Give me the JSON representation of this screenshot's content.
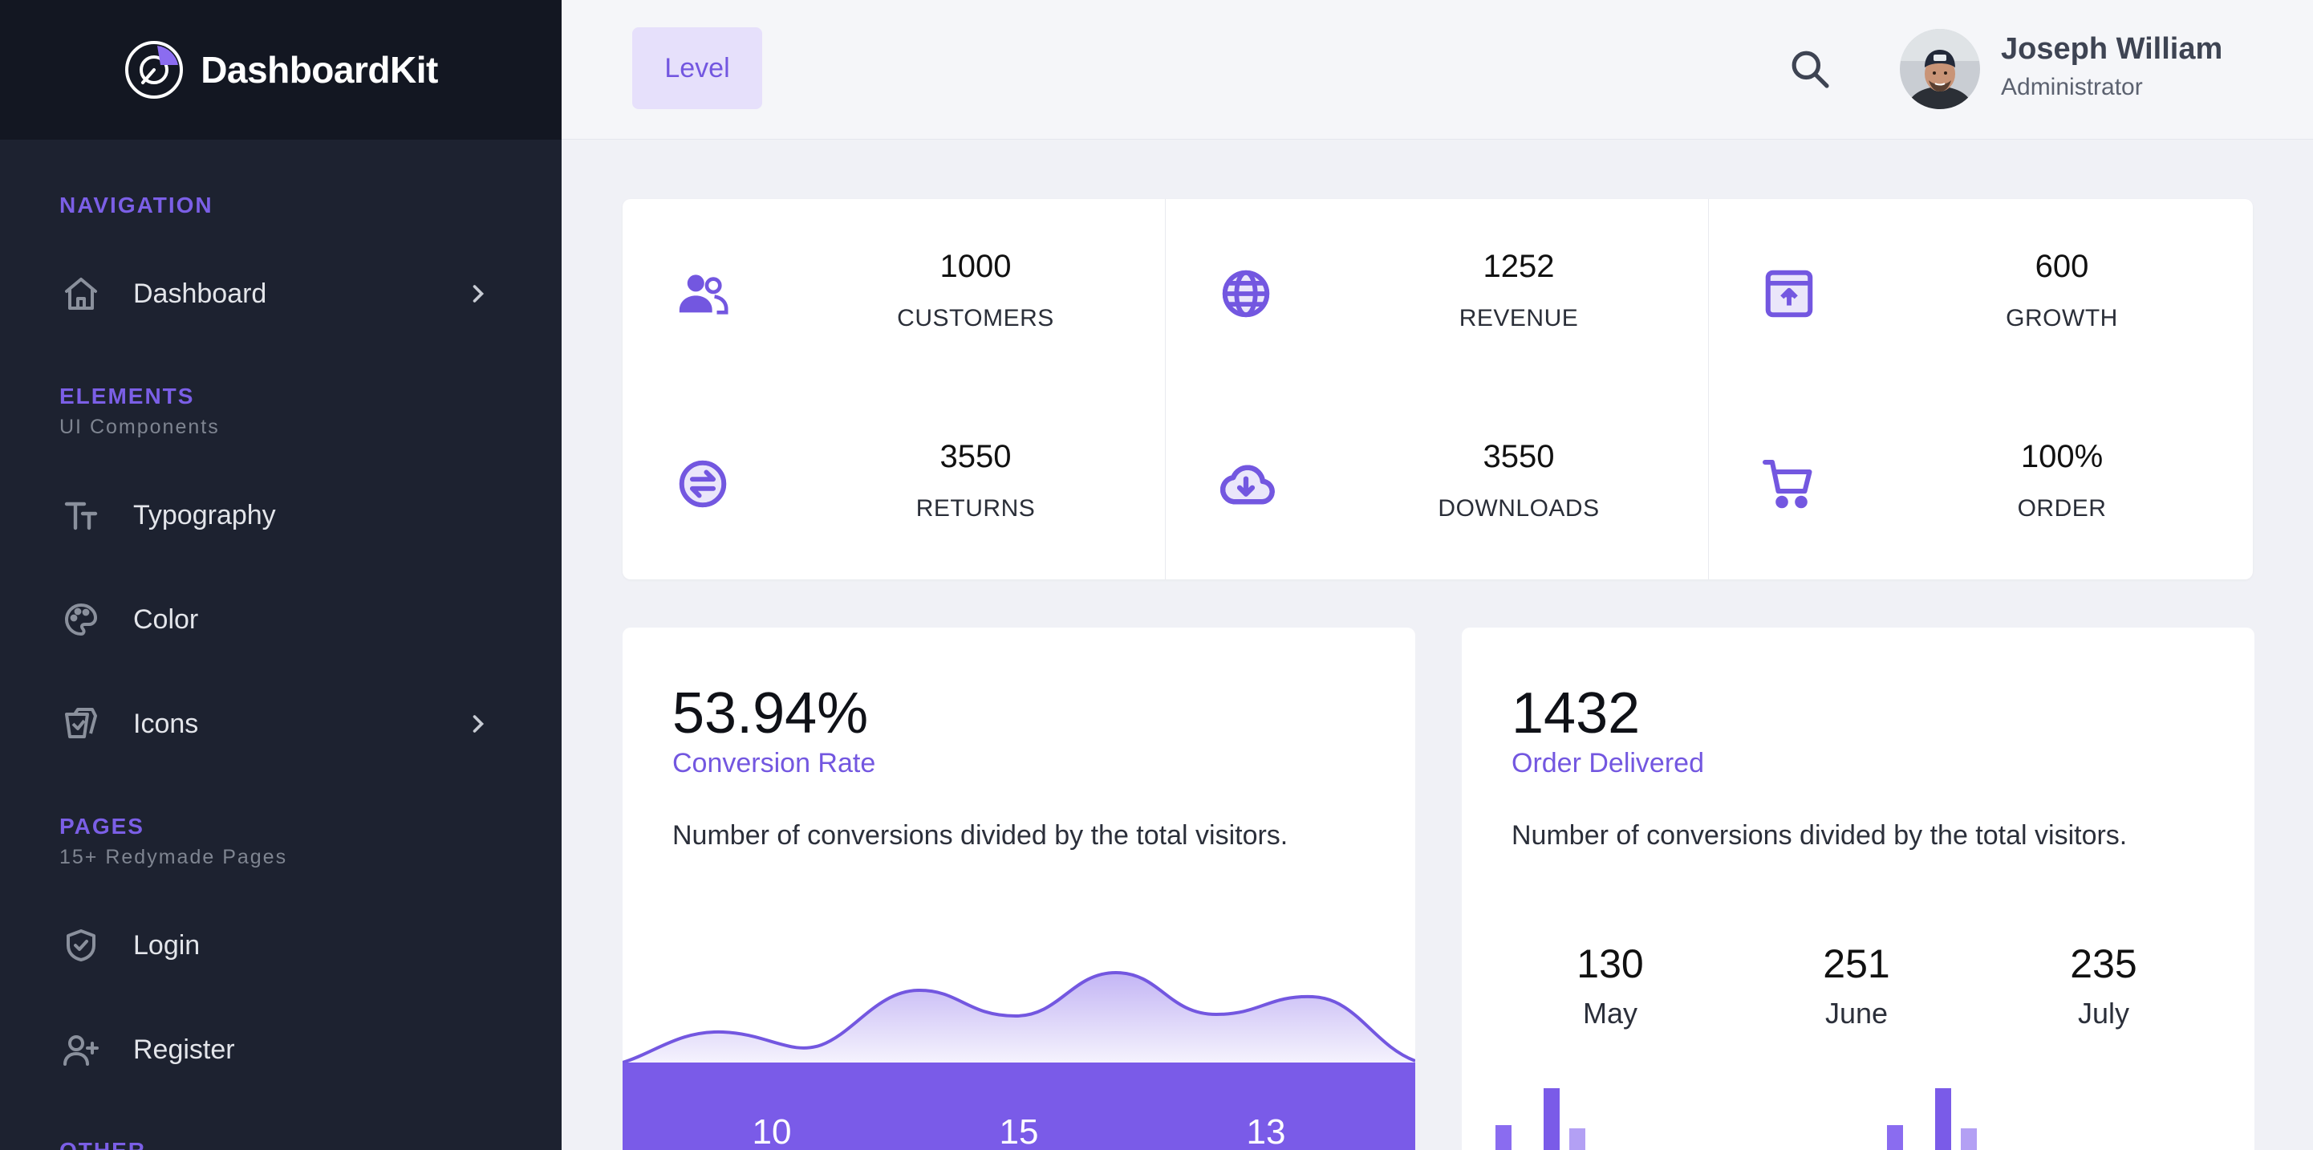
{
  "brand": {
    "name": "DashboardKit"
  },
  "sidebar": {
    "sections": [
      {
        "caption": "NAVIGATION",
        "sub": ""
      },
      {
        "caption": "ELEMENTS",
        "sub": "UI Components"
      },
      {
        "caption": "PAGES",
        "sub": "15+ Redymade Pages"
      },
      {
        "caption": "OTHER",
        "sub": ""
      }
    ],
    "items": [
      {
        "label": "Dashboard",
        "icon": "home-icon",
        "has_submenu": true
      },
      {
        "label": "Typography",
        "icon": "text-size-icon",
        "has_submenu": false
      },
      {
        "label": "Color",
        "icon": "palette-icon",
        "has_submenu": false
      },
      {
        "label": "Icons",
        "icon": "icons-icon",
        "has_submenu": true
      },
      {
        "label": "Login",
        "icon": "shield-check-icon",
        "has_submenu": false
      },
      {
        "label": "Register",
        "icon": "user-plus-icon",
        "has_submenu": false
      }
    ]
  },
  "header": {
    "level_label": "Level",
    "user": {
      "name": "Joseph William",
      "role": "Administrator"
    }
  },
  "stats": [
    {
      "value": "1000",
      "label": "CUSTOMERS",
      "icon": "users-icon"
    },
    {
      "value": "1252",
      "label": "REVENUE",
      "icon": "globe-icon"
    },
    {
      "value": "600",
      "label": "GROWTH",
      "icon": "archive-upload-icon"
    },
    {
      "value": "3550",
      "label": "RETURNS",
      "icon": "exchange-icon"
    },
    {
      "value": "3550",
      "label": "DOWNLOADS",
      "icon": "cloud-download-icon"
    },
    {
      "value": "100%",
      "label": "ORDER",
      "icon": "cart-icon"
    }
  ],
  "conversion_card": {
    "value": "53.94%",
    "label": "Conversion Rate",
    "description": "Number of conversions divided by the total visitors.",
    "footer_values": [
      "10",
      "15",
      "13"
    ]
  },
  "order_card": {
    "value": "1432",
    "label": "Order Delivered",
    "description": "Number of conversions divided by the total visitors.",
    "months": [
      {
        "value": "130",
        "label": "May"
      },
      {
        "value": "251",
        "label": "June"
      },
      {
        "value": "235",
        "label": "July"
      }
    ]
  },
  "colors": {
    "accent": "#7357e0",
    "sidebar_bg": "#1d2230",
    "brand_bg": "#131722",
    "page_bg": "#f0f1f6"
  }
}
